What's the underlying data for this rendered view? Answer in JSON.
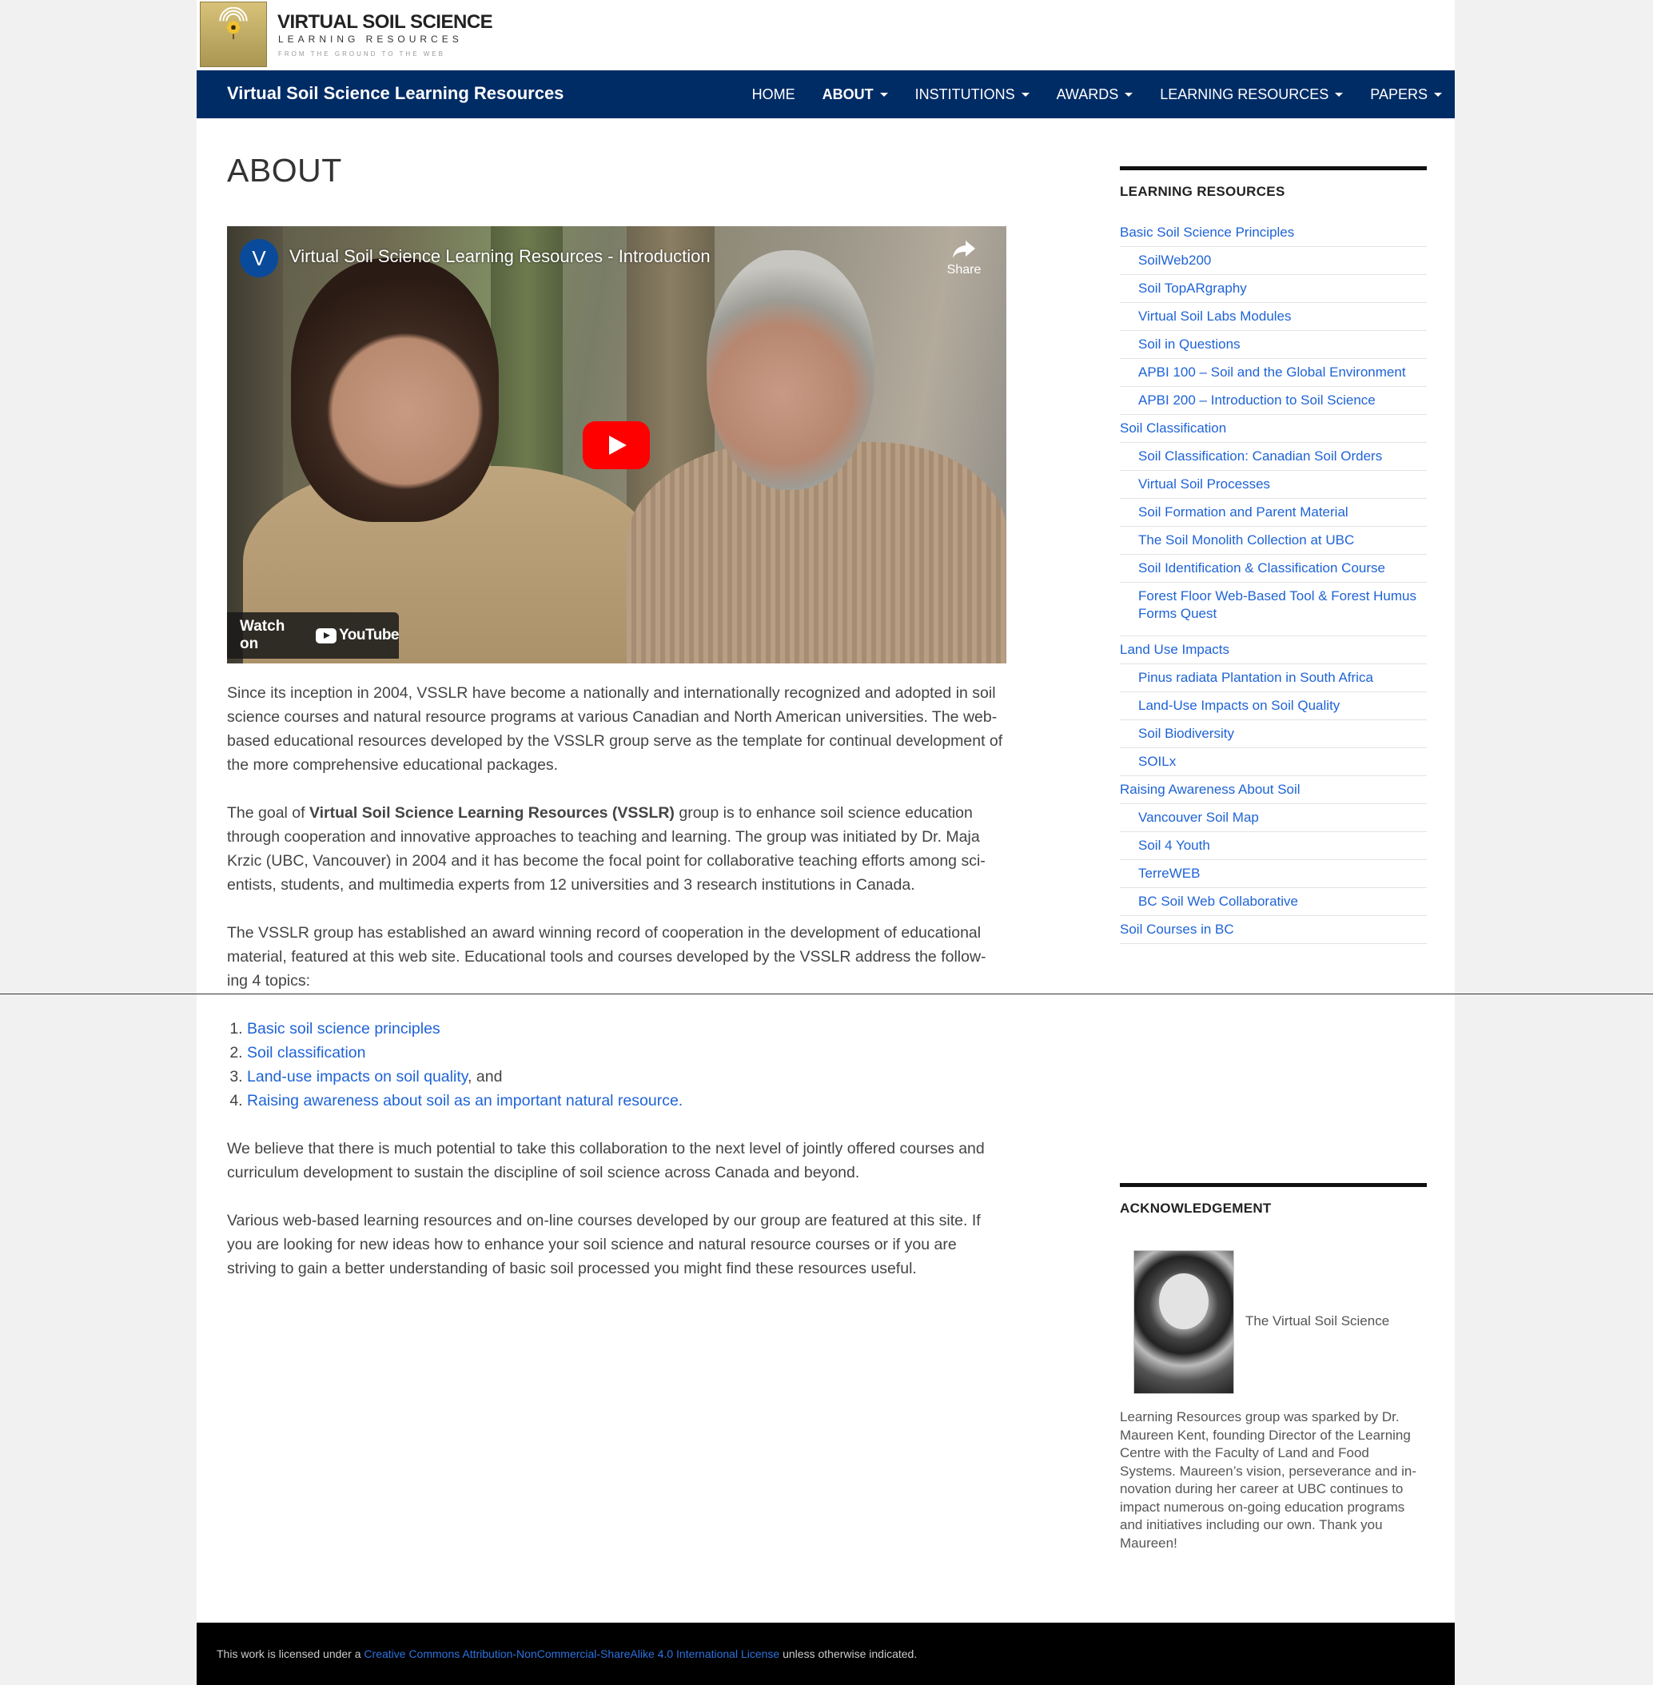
{
  "header": {
    "logo_title": "VIRTUAL SOIL SCIENCE",
    "logo_subtitle": "LEARNING RESOURCES",
    "logo_tagline": "FROM THE GROUND TO THE WEB"
  },
  "navbar": {
    "brand": "Virtual Soil Science Learning Resources",
    "items": [
      {
        "label": "HOME",
        "dropdown": false
      },
      {
        "label": "ABOUT",
        "dropdown": true
      },
      {
        "label": "INSTITUTIONS",
        "dropdown": true
      },
      {
        "label": "AWARDS",
        "dropdown": true
      },
      {
        "label": "LEARNING RESOURCES",
        "dropdown": true
      },
      {
        "label": "PAPERS",
        "dropdown": true
      }
    ]
  },
  "main": {
    "title": "ABOUT",
    "video": {
      "channel_initial": "V",
      "title": "Virtual Soil Science Learning Resources - Introduction",
      "share_label": "Share",
      "watch_label": "Watch on",
      "youtube_label": "YouTube"
    },
    "para1": "Since its inception in 2004, VSSLR have become a nationally and internationally recognized and adopted in soil science courses and natural resource programs at various Canadian and North American universities. The web-based educational resources developed by the VSSLR group serve as the template for continual development of the more comprehensive educational packages.",
    "para2_pre": "The goal of ",
    "para2_bold": "Virtual Soil Science Learning Resources (VSSLR)",
    "para2_post": " group is to enhance soil science education through cooperation and innovative approaches to teaching and learning. The group was initiated by Dr. Maja Krzic (UBC, Vancouver) in 2004 and it has become the focal point for collaborative teaching efforts among sci-entists, students, and multimedia experts from 12 universities and 3 research institutions in Canada.",
    "para3": "The VSSLR group has established an award winning record of cooperation in the development of educational material, featured at this web site. Educational tools and courses developed by the VSSLR address the follow-ing 4 topics:",
    "topics": [
      {
        "link": "Basic soil science principles",
        "suffix": ""
      },
      {
        "link": "Soil classification",
        "suffix": ""
      },
      {
        "link": "Land-use impacts on soil quality",
        "suffix": ", and"
      },
      {
        "link": "Raising awareness about soil as an important natural resource.",
        "suffix": ""
      }
    ],
    "para4": "We believe that there is much potential to take this collaboration to the next level of jointly offered courses and curriculum development to sustain the discipline of soil science across Canada and beyond.",
    "para5": "Various web-based learning resources and on-line courses developed by our group are featured at this site. If you are looking for new ideas how to enhance your soil science and natural resource courses or if you are striving to gain a better understanding of basic soil processed you might find these resources useful."
  },
  "sidebar": {
    "resources_title": "LEARNING RESOURCES",
    "resources": [
      {
        "label": "Basic Soil Science Principles",
        "level": 0
      },
      {
        "label": "SoilWeb200",
        "level": 1
      },
      {
        "label": "Soil TopARgraphy",
        "level": 1
      },
      {
        "label": "Virtual Soil Labs Modules",
        "level": 1
      },
      {
        "label": "Soil in Questions",
        "level": 1
      },
      {
        "label": "APBI 100 – Soil and the Global Environment",
        "level": 1
      },
      {
        "label": "APBI 200 – Introduction to Soil Science",
        "level": 1
      },
      {
        "label": "Soil Classification",
        "level": 0
      },
      {
        "label": "Soil Classification: Canadian Soil Orders",
        "level": 1
      },
      {
        "label": "Virtual Soil Processes",
        "level": 1
      },
      {
        "label": "Soil Formation and Parent Material",
        "level": 1
      },
      {
        "label": "The Soil Monolith Collection at UBC",
        "level": 1
      },
      {
        "label": "Soil Identification & Classification Course",
        "level": 1
      },
      {
        "label": "Forest Floor Web-Based Tool & Forest Humus Forms Quest",
        "level": 1
      },
      {
        "label": "Land Use Impacts",
        "level": 0
      },
      {
        "label": "Pinus radiata Plantation in South Africa",
        "level": 1
      },
      {
        "label": "Land-Use Impacts on Soil Quality",
        "level": 1
      },
      {
        "label": "Soil Biodiversity",
        "level": 1
      },
      {
        "label": "SOILx",
        "level": 1
      },
      {
        "label": "Raising Awareness About Soil",
        "level": 0
      },
      {
        "label": "Vancouver Soil Map",
        "level": 1
      },
      {
        "label": "Soil 4 Youth",
        "level": 1
      },
      {
        "label": "TerreWEB",
        "level": 1
      },
      {
        "label": "BC Soil Web Collaborative",
        "level": 1
      },
      {
        "label": "Soil Courses in BC",
        "level": 0
      }
    ],
    "ack_title": "ACKNOWLEDGEMENT",
    "ack_lead": "The Virtual Soil Science",
    "ack_text": "Learning Resources group was sparked by Dr. Maureen Kent, founding Director of the Learning Centre with the Faculty of Land and Food Systems. Maureen’s vision, perseverance and in-novation during her career at UBC continues to impact numerous on-going education programs and initiatives including our own. Thank you Maureen!"
  },
  "footer": {
    "pre": "This work is licensed under a ",
    "link": "Creative Commons Attribution-NonCommercial-ShareAlike 4.0 International License",
    "post": " unless otherwise indicated."
  },
  "colors": {
    "navbar": "#002c65",
    "link": "#1e63d6",
    "footer": "#000000"
  }
}
